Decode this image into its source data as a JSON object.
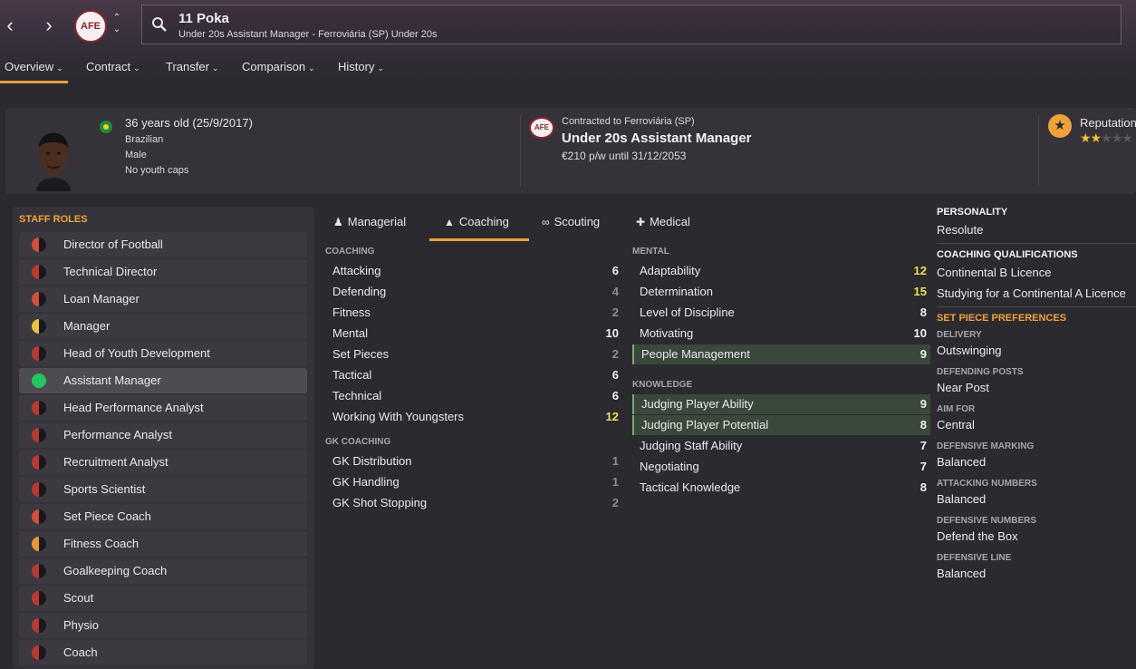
{
  "header": {
    "club_badge_text": "AFE",
    "title": "11 Poka",
    "subtitle": "Under 20s Assistant Manager - Ferroviária (SP) Under 20s"
  },
  "tabs": [
    {
      "label": "Overview"
    },
    {
      "label": "Contract"
    },
    {
      "label": "Transfer"
    },
    {
      "label": "Comparison"
    },
    {
      "label": "History"
    }
  ],
  "profile": {
    "age": "36 years old (25/9/2017)",
    "nationality": "Brazilian",
    "gender": "Male",
    "caps": "No youth caps"
  },
  "contract": {
    "club_badge_text": "AFE",
    "contracted_to": "Contracted to Ferroviária (SP)",
    "role": "Under 20s Assistant Manager",
    "wage": "€210 p/w until 31/12/2053"
  },
  "reputation": {
    "label": "Reputation",
    "stars": 2
  },
  "staff_roles": {
    "title": "STAFF ROLES",
    "items": [
      {
        "label": "Director of Football",
        "suitability": "poor"
      },
      {
        "label": "Technical Director",
        "suitability": "very_poor"
      },
      {
        "label": "Loan Manager",
        "suitability": "poor"
      },
      {
        "label": "Manager",
        "suitability": "average"
      },
      {
        "label": "Head of Youth Development",
        "suitability": "very_poor"
      },
      {
        "label": "Assistant Manager",
        "suitability": "excellent"
      },
      {
        "label": "Head Performance Analyst",
        "suitability": "very_poor"
      },
      {
        "label": "Performance Analyst",
        "suitability": "very_poor"
      },
      {
        "label": "Recruitment Analyst",
        "suitability": "very_poor"
      },
      {
        "label": "Sports Scientist",
        "suitability": "very_poor"
      },
      {
        "label": "Set Piece Coach",
        "suitability": "poor"
      },
      {
        "label": "Fitness Coach",
        "suitability": "below_average"
      },
      {
        "label": "Goalkeeping Coach",
        "suitability": "very_poor"
      },
      {
        "label": "Scout",
        "suitability": "very_poor"
      },
      {
        "label": "Physio",
        "suitability": "very_poor"
      },
      {
        "label": "Coach",
        "suitability": "very_poor"
      }
    ]
  },
  "attribute_tabs": [
    {
      "label": "Managerial",
      "icon": "person-icon"
    },
    {
      "label": "Coaching",
      "icon": "cone-icon"
    },
    {
      "label": "Scouting",
      "icon": "binoculars-icon"
    },
    {
      "label": "Medical",
      "icon": "medkit-icon"
    }
  ],
  "coaching": {
    "label": "COACHING",
    "items": [
      {
        "name": "Attacking",
        "value": "6"
      },
      {
        "name": "Defending",
        "value": "4"
      },
      {
        "name": "Fitness",
        "value": "2"
      },
      {
        "name": "Mental",
        "value": "10"
      },
      {
        "name": "Set Pieces",
        "value": "2"
      },
      {
        "name": "Tactical",
        "value": "6"
      },
      {
        "name": "Technical",
        "value": "6"
      },
      {
        "name": "Working With Youngsters",
        "value": "12"
      }
    ]
  },
  "gk_coaching": {
    "label": "GK COACHING",
    "items": [
      {
        "name": "GK Distribution",
        "value": "1"
      },
      {
        "name": "GK Handling",
        "value": "1"
      },
      {
        "name": "GK Shot Stopping",
        "value": "2"
      }
    ]
  },
  "mental": {
    "label": "MENTAL",
    "items": [
      {
        "name": "Adaptability",
        "value": "12",
        "highlight": false
      },
      {
        "name": "Determination",
        "value": "15",
        "highlight": false
      },
      {
        "name": "Level of Discipline",
        "value": "8",
        "highlight": false
      },
      {
        "name": "Motivating",
        "value": "10",
        "highlight": false
      },
      {
        "name": "People Management",
        "value": "9",
        "highlight": true
      }
    ]
  },
  "knowledge": {
    "label": "KNOWLEDGE",
    "items": [
      {
        "name": "Judging Player Ability",
        "value": "9",
        "highlight": true
      },
      {
        "name": "Judging Player Potential",
        "value": "8",
        "highlight": true
      },
      {
        "name": "Judging Staff Ability",
        "value": "7",
        "highlight": false
      },
      {
        "name": "Negotiating",
        "value": "7",
        "highlight": false
      },
      {
        "name": "Tactical Knowledge",
        "value": "8",
        "highlight": false
      }
    ]
  },
  "right_panel": {
    "personality_head": "PERSONALITY",
    "personality": "Resolute",
    "qualifications_head": "COACHING QUALIFICATIONS",
    "qualifications": [
      "Continental B Licence",
      "Studying for a Continental A Licence"
    ],
    "set_piece_head": "SET PIECE PREFERENCES",
    "set_piece": [
      {
        "label": "DELIVERY",
        "value": "Outswinging"
      },
      {
        "label": "DEFENDING POSTS",
        "value": "Near Post"
      },
      {
        "label": "AIM FOR",
        "value": "Central"
      },
      {
        "label": "DEFENSIVE MARKING",
        "value": "Balanced"
      },
      {
        "label": "ATTACKING NUMBERS",
        "value": "Balanced"
      },
      {
        "label": "DEFENSIVE NUMBERS",
        "value": "Defend the Box"
      },
      {
        "label": "DEFENSIVE LINE",
        "value": "Balanced"
      }
    ]
  },
  "colors": {
    "accent": "#f0a23a",
    "suitability": {
      "excellent": "#22c55e",
      "average": "#e8c240",
      "below_average": "#e8963a",
      "poor": "#d0503c",
      "very_poor": "#b83a32"
    }
  }
}
